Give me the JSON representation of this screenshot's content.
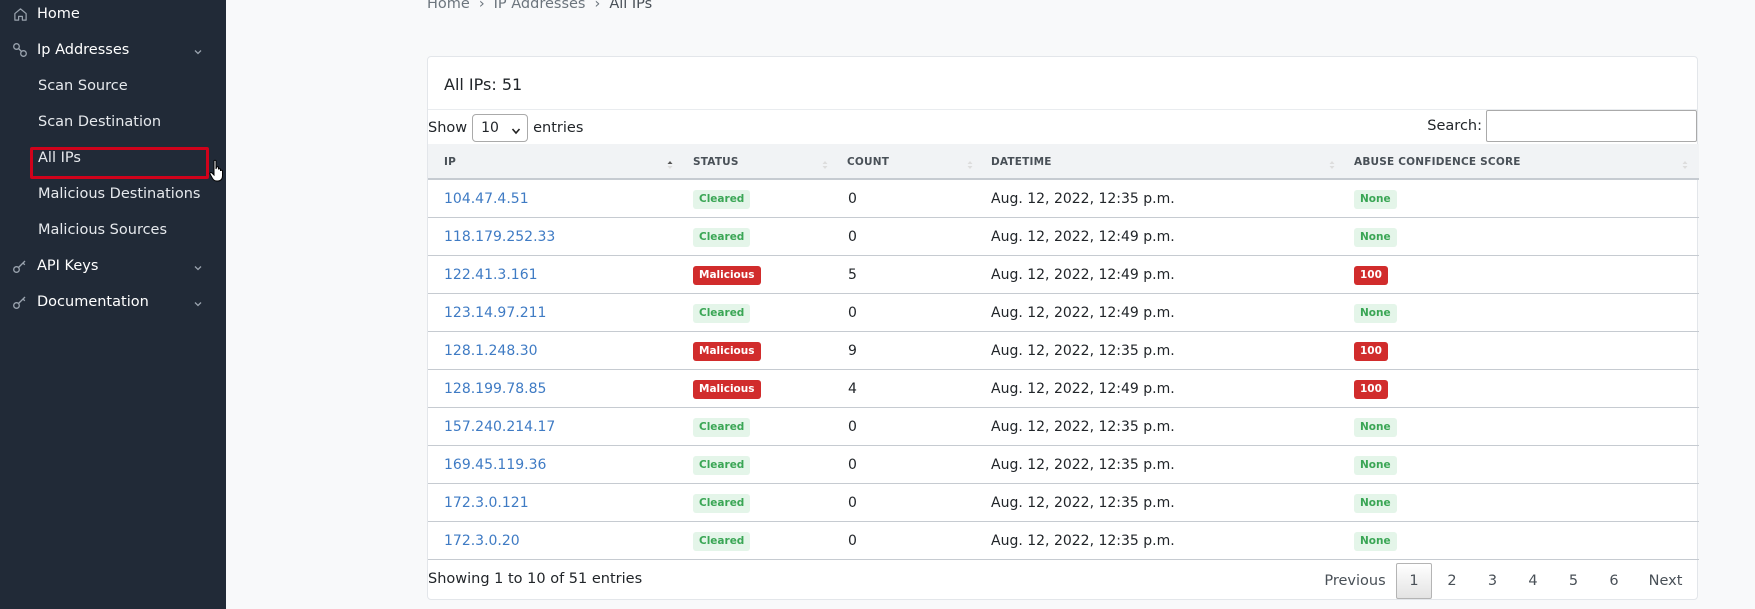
{
  "sidebar": {
    "items": [
      {
        "label": "Home"
      },
      {
        "label": "Ip Addresses"
      },
      {
        "label": "API Keys"
      },
      {
        "label": "Documentation"
      }
    ],
    "sub_items": [
      {
        "label": "Scan Source"
      },
      {
        "label": "Scan Destination"
      },
      {
        "label": "All IPs"
      },
      {
        "label": "Malicious Destinations"
      },
      {
        "label": "Malicious Sources"
      }
    ]
  },
  "breadcrumb": {
    "items": [
      "Home",
      "IP Addresses",
      "All IPs"
    ],
    "separator": "›"
  },
  "card": {
    "title": "All IPs: 51"
  },
  "controls": {
    "show_label": "Show",
    "entries_value": "10",
    "entries_label": "entries",
    "search_label": "Search:",
    "search_value": ""
  },
  "table": {
    "headers": [
      "IP",
      "STATUS",
      "COUNT",
      "DATETIME",
      "ABUSE CONFIDENCE SCORE"
    ],
    "rows": [
      {
        "ip": "104.47.4.51",
        "status": "Cleared",
        "count": "0",
        "datetime": "Aug. 12, 2022, 12:35 p.m.",
        "score": "None"
      },
      {
        "ip": "118.179.252.33",
        "status": "Cleared",
        "count": "0",
        "datetime": "Aug. 12, 2022, 12:49 p.m.",
        "score": "None"
      },
      {
        "ip": "122.41.3.161",
        "status": "Malicious",
        "count": "5",
        "datetime": "Aug. 12, 2022, 12:49 p.m.",
        "score": "100"
      },
      {
        "ip": "123.14.97.211",
        "status": "Cleared",
        "count": "0",
        "datetime": "Aug. 12, 2022, 12:49 p.m.",
        "score": "None"
      },
      {
        "ip": "128.1.248.30",
        "status": "Malicious",
        "count": "9",
        "datetime": "Aug. 12, 2022, 12:35 p.m.",
        "score": "100"
      },
      {
        "ip": "128.199.78.85",
        "status": "Malicious",
        "count": "4",
        "datetime": "Aug. 12, 2022, 12:49 p.m.",
        "score": "100"
      },
      {
        "ip": "157.240.214.17",
        "status": "Cleared",
        "count": "0",
        "datetime": "Aug. 12, 2022, 12:35 p.m.",
        "score": "None"
      },
      {
        "ip": "169.45.119.36",
        "status": "Cleared",
        "count": "0",
        "datetime": "Aug. 12, 2022, 12:35 p.m.",
        "score": "None"
      },
      {
        "ip": "172.3.0.121",
        "status": "Cleared",
        "count": "0",
        "datetime": "Aug. 12, 2022, 12:35 p.m.",
        "score": "None"
      },
      {
        "ip": "172.3.0.20",
        "status": "Cleared",
        "count": "0",
        "datetime": "Aug. 12, 2022, 12:35 p.m.",
        "score": "None"
      }
    ]
  },
  "footer": {
    "info": "Showing 1 to 10 of 51 entries",
    "previous": "Previous",
    "pages": [
      "1",
      "2",
      "3",
      "4",
      "5",
      "6"
    ],
    "next": "Next",
    "current_page": "1"
  },
  "colors": {
    "sidebar_bg": "#212a37",
    "link": "#3f7bc4",
    "danger": "#d12c2c",
    "success": "#3aa655",
    "highlight": "#d0021b"
  }
}
